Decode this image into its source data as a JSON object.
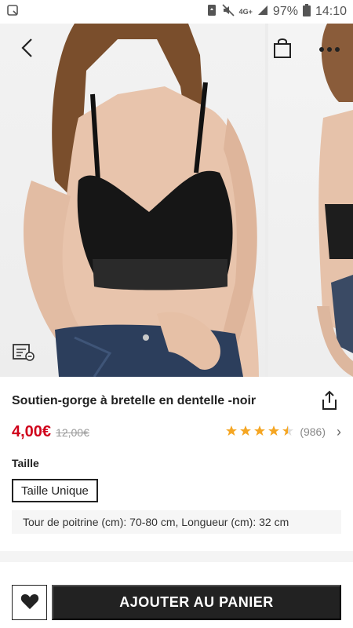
{
  "status_bar": {
    "battery": "97%",
    "network": "4G+",
    "time": "14:10"
  },
  "product": {
    "title": "Soutien-gorge à bretelle en dentelle -noir",
    "price": "4,00€",
    "original_price": "12,00€",
    "rating": 4.5,
    "review_count": "(986)"
  },
  "size": {
    "label": "Taille",
    "selected": "Taille Unique",
    "measurements": "Tour de poitrine (cm): 70-80 cm, Longueur (cm): 32 cm"
  },
  "actions": {
    "add_to_cart": "AJOUTER AU PANIER"
  },
  "colors": {
    "price": "#d0021b",
    "stars": "#f5a623",
    "button": "#222222"
  },
  "icons": [
    "back-icon",
    "shopping-bag-icon",
    "more-icon",
    "size-guide-icon",
    "share-icon",
    "heart-icon",
    "chevron-right-icon"
  ]
}
